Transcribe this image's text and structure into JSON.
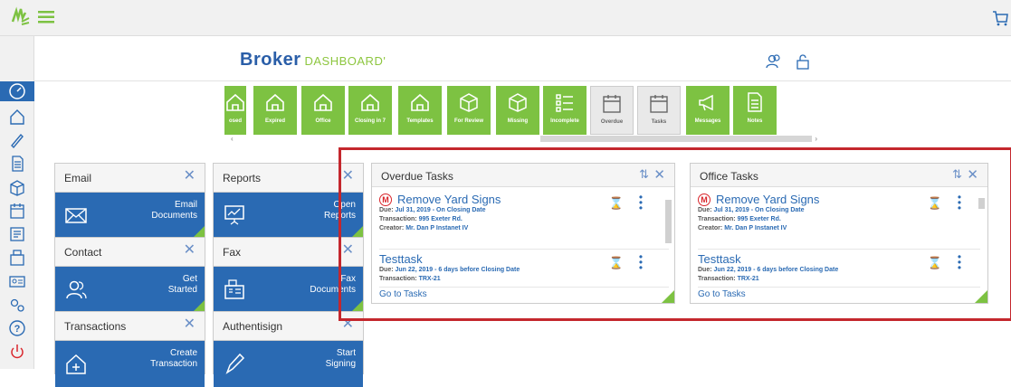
{
  "brand": {
    "name": "Broker",
    "sub": "DASHBOARD",
    "tm": "'"
  },
  "tiles": [
    {
      "label": "osed",
      "icon": "house-icon",
      "gray": false
    },
    {
      "label": "Expired",
      "icon": "house-icon",
      "gray": false
    },
    {
      "label": "Office",
      "icon": "house-icon",
      "gray": false
    },
    {
      "label": "Closing in 7",
      "icon": "house-icon",
      "gray": false
    },
    {
      "label": "Templates",
      "icon": "house-icon",
      "gray": false
    },
    {
      "label": "For Review",
      "icon": "box-icon",
      "gray": false
    },
    {
      "label": "Missing",
      "icon": "box-icon",
      "gray": false
    },
    {
      "label": "Incomplete",
      "icon": "checklist-icon",
      "gray": false
    },
    {
      "label": "Overdue",
      "icon": "calendar-icon",
      "gray": true
    },
    {
      "label": "Tasks",
      "icon": "calendar-icon",
      "gray": true
    },
    {
      "label": "Messages",
      "icon": "megaphone-icon",
      "gray": false
    },
    {
      "label": "Notes",
      "icon": "note-icon",
      "gray": false
    }
  ],
  "cards": {
    "email": {
      "title": "Email",
      "close": "✕",
      "action1": "Email",
      "action2": "Documents"
    },
    "reports": {
      "title": "Reports",
      "close": "✕",
      "action1": "Open",
      "action2": "Reports"
    },
    "contact": {
      "title": "Contact",
      "close": "✕",
      "action1": "Get",
      "action2": "Started"
    },
    "fax": {
      "title": "Fax",
      "close": "✕",
      "action1": "Fax",
      "action2": "Documents"
    },
    "transactions": {
      "title": "Transactions",
      "close": "✕",
      "action1": "Create",
      "action2": "Transaction"
    },
    "authentisign": {
      "title": "Authentisign",
      "close": "✕",
      "action1": "Start",
      "action2": "Signing"
    }
  },
  "overdue": {
    "title": "Overdue Tasks",
    "footer": "Go to Tasks",
    "tasks": [
      {
        "badge": "M",
        "title": "Remove Yard Signs",
        "due_label": "Due:",
        "due": "Jul 31, 2019 - On Closing Date",
        "tx_label": "Transaction:",
        "tx": "995 Exeter Rd.",
        "creator_label": "Creator:",
        "creator": "Mr. Dan P Instanet IV"
      },
      {
        "title": "Testtask",
        "due_label": "Due:",
        "due": "Jun 22, 2019 - 6 days before Closing Date",
        "tx_label": "Transaction:",
        "tx": "TRX-21"
      }
    ]
  },
  "office": {
    "title": "Office Tasks",
    "footer": "Go to Tasks",
    "tasks": [
      {
        "badge": "M",
        "title": "Remove Yard Signs",
        "due_label": "Due:",
        "due": "Jul 31, 2019 - On Closing Date",
        "tx_label": "Transaction:",
        "tx": "995 Exeter Rd.",
        "creator_label": "Creator:",
        "creator": "Mr. Dan P Instanet IV"
      },
      {
        "title": "Testtask",
        "due_label": "Due:",
        "due": "Jun 22, 2019 - 6 days before Closing Date",
        "tx_label": "Transaction:",
        "tx": "TRX-21"
      }
    ]
  },
  "icons": {
    "hourglass": "⌛",
    "sort": "⇅",
    "close": "✕"
  },
  "colors": {
    "primary": "#2a6ab3",
    "accent": "#7dc242",
    "highlight": "#c4272d"
  }
}
